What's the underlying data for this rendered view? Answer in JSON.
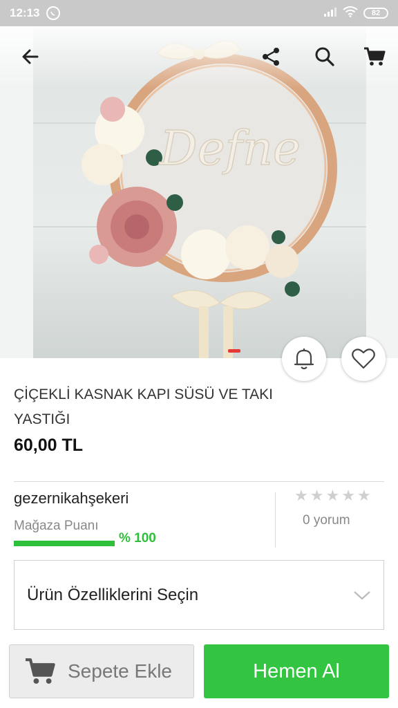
{
  "status_bar": {
    "time": "12:13",
    "battery": "82",
    "icons": [
      "whatsapp-icon",
      "signal-icon",
      "wifi-icon",
      "battery-icon"
    ]
  },
  "toolbar": {
    "icons": [
      "back-arrow-icon",
      "share-icon",
      "search-icon",
      "cart-icon"
    ]
  },
  "hero": {
    "image_text": "Defne",
    "pager": {
      "current": 1
    }
  },
  "actions": {
    "icons": [
      "bell-icon",
      "heart-icon"
    ]
  },
  "product": {
    "title": "ÇİÇEKLİ KASNAK KAPI SÜSÜ VE TAKI YASTIĞI",
    "price": "60,00 TL"
  },
  "store": {
    "name": "gezernikahşekeri",
    "rating_label": "Mağaza Puanı",
    "rating_value": "% 100",
    "rating_percent": 100
  },
  "reviews": {
    "stars_filled": 0,
    "stars_total": 5,
    "count_label": "0 yorum"
  },
  "options": {
    "label": "Ürün Özelliklerini Seçin"
  },
  "buttons": {
    "add_to_cart": "Sepete Ekle",
    "buy_now": "Hemen Al"
  },
  "colors": {
    "accent_green": "#33c542",
    "rating_green": "#2fbf3a",
    "pager_red": "#e53935"
  }
}
